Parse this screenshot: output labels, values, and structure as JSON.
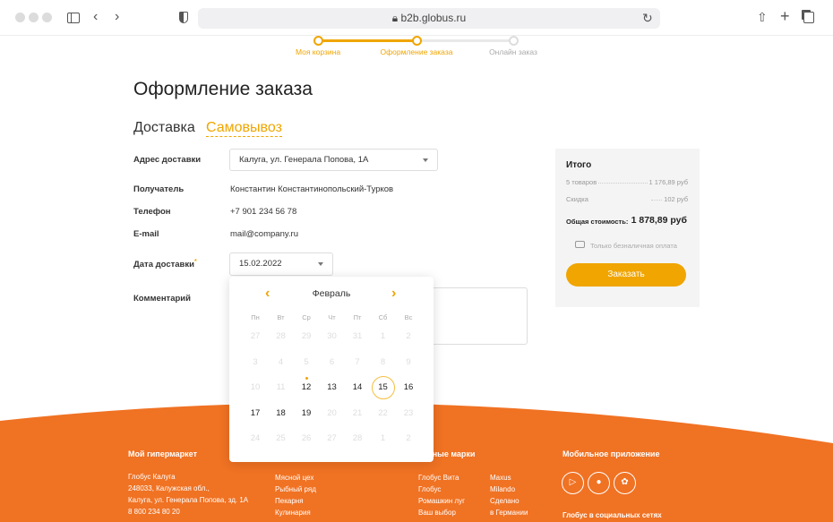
{
  "browser": {
    "url": "b2b.globus.ru"
  },
  "steps": [
    {
      "label": "Моя корзина",
      "state": "done"
    },
    {
      "label": "Оформление заказа",
      "state": "active"
    },
    {
      "label": "Онлайн заказ",
      "state": "pending"
    }
  ],
  "page_title": "Оформление заказа",
  "tabs": [
    {
      "label": "Доставка",
      "active": false
    },
    {
      "label": "Самовывоз",
      "active": true
    }
  ],
  "form": {
    "address_label": "Адрес доставки",
    "address_value": "Калуга, ул. Генерала Попова, 1А",
    "recipient_label": "Получатель",
    "recipient_value": "Константин Константинопольский-Турков",
    "phone_label": "Телефон",
    "phone_value": "+7 901 234 56 78",
    "email_label": "E-mail",
    "email_value": "mail@company.ru",
    "date_label": "Дата доставки",
    "required_mark": "*",
    "date_value": "15.02.2022",
    "comment_label": "Комментарий",
    "comment_value": ""
  },
  "calendar": {
    "month": "Февраль",
    "weekdays": [
      "Пн",
      "Вт",
      "Ср",
      "Чт",
      "Пт",
      "Сб",
      "Вс"
    ],
    "weeks": [
      [
        "27",
        "28",
        "29",
        "30",
        "31",
        "1",
        "2"
      ],
      [
        "3",
        "4",
        "5",
        "6",
        "7",
        "8",
        "9"
      ],
      [
        "10",
        "11",
        "12",
        "13",
        "14",
        "15",
        "16"
      ],
      [
        "17",
        "18",
        "19",
        "20",
        "21",
        "22",
        "23"
      ],
      [
        "24",
        "25",
        "26",
        "27",
        "28",
        "1",
        "2"
      ]
    ],
    "available": [
      "2-2",
      "2-3",
      "2-4",
      "2-5",
      "2-6",
      "3-0",
      "3-1",
      "3-2"
    ],
    "selected": "2-5",
    "today": "2-2"
  },
  "summary": {
    "title": "Итого",
    "items_label": "5 товаров",
    "items_value": "1 176,89 руб",
    "discount_label": "Скидка",
    "discount_value": "102 руб",
    "total_label": "Общая стоимость:",
    "total_value": "1 878,89 руб",
    "cashless_label": "Только безналичная оплата",
    "order_button": "Заказать"
  },
  "footer": {
    "col1_title": "Мой гипермаркет",
    "col1_lines": [
      "Глобус Калуга",
      "248033, Калужская обл.,",
      "Калуга, ул. Генерала Попова, зд. 1А",
      "8 800 234 80 20"
    ],
    "col2_lines": [
      "Мясной цех",
      "Рыбный ряд",
      "Пекарня",
      "Кулинария"
    ],
    "col3_title": "Собственные марки",
    "col3a": [
      "Глобус Вита",
      "Глобус",
      "Ромашкин луг",
      "Ваш выбор"
    ],
    "col3b": [
      "Maxus",
      "Milando",
      "Сделано",
      "в Германии"
    ],
    "col4_title": "Мобильное приложение",
    "col4_social": "Глобус в социальных сетях"
  },
  "colors": {
    "accent": "#f0a500",
    "footer": "#f07223"
  }
}
